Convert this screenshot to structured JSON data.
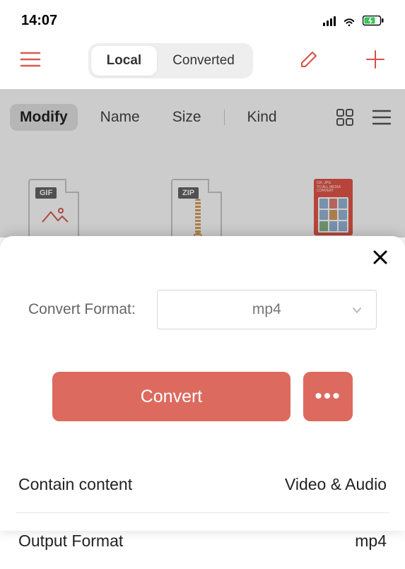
{
  "status": {
    "time": "14:07"
  },
  "tabs": {
    "local": "Local",
    "converted": "Converted",
    "active": "Local"
  },
  "filters": {
    "items": [
      "Modify",
      "Name",
      "Size",
      "Kind"
    ],
    "active": "Modify"
  },
  "files": [
    {
      "badge": "GIF",
      "kind": "gif"
    },
    {
      "badge": "ZIP",
      "kind": "zip"
    },
    {
      "kind": "poster"
    }
  ],
  "sheet": {
    "format_label": "Convert Format:",
    "format_value": "mp4",
    "convert_label": "Convert",
    "more_label": "•••",
    "rows": [
      {
        "label": "Contain content",
        "value": "Video & Audio"
      },
      {
        "label": "Output Format",
        "value": "mp4"
      }
    ]
  }
}
